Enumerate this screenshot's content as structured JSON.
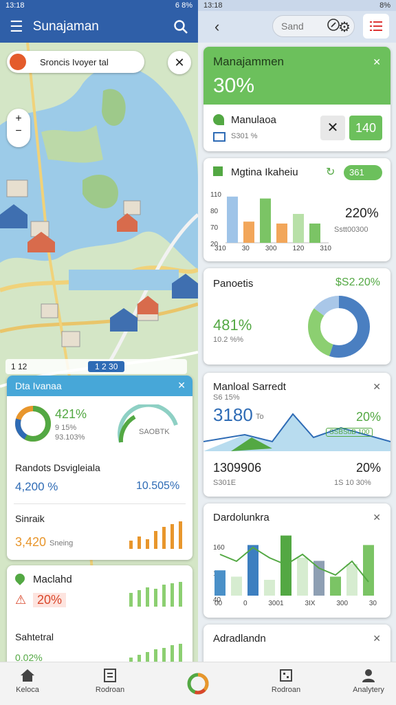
{
  "status_left": {
    "time": "13:18",
    "right": "6 8%"
  },
  "status_right": {
    "time": "13:18",
    "right": "8%"
  },
  "appbar": {
    "title": "Sunajaman"
  },
  "search": {
    "placeholder": "Sand"
  },
  "map": {
    "chip_label": "Sroncis Ivoyer tal",
    "scale_left": "1 12",
    "scale_mid": "1 2 30"
  },
  "card_data": {
    "title": "Dta Ivanaa",
    "donut_value": "421%",
    "donut_sub1": "9 15%",
    "donut_sub2": "93.103%",
    "gauge_label": "SAOBTK",
    "row1_label": "Randots Dsvigleiala",
    "row1_left": "4,200 %",
    "row1_right": "10.505%",
    "row2_label": "Sinraik",
    "row2_value": "3,420",
    "row2_sub": "Sneing"
  },
  "card_macland": {
    "title": "Maclahd",
    "value": "20%",
    "row_label": "Sahtetral",
    "row_value": "0.02%"
  },
  "card_management": {
    "title": "Manajammen",
    "value": "30%",
    "sub_label": "Manulaoa",
    "sub_value": "S301 %",
    "button_value": "140"
  },
  "card_matina": {
    "title": "Mgtina Ikaheiu",
    "badge": "361",
    "y_labels": [
      "110",
      "80",
      "70",
      "20"
    ],
    "x_labels": [
      "310",
      "30",
      "300",
      "120",
      "310"
    ],
    "value": "220%",
    "sub": "Sstt00300"
  },
  "card_panoetis": {
    "title": "Panoetis",
    "value_top": "$S2.20%",
    "value_mid": "481%",
    "sub": "10.2 %%"
  },
  "card_manual": {
    "title": "Manloal Sarredt",
    "sub_top": "S6 15%",
    "value_left": "3180",
    "unit_left": "To",
    "value_right": "20%",
    "sub_right": "SSBSuB 100",
    "bottom_left": "1309906",
    "bottom_right": "20%",
    "bottom_sub_left": "S301E",
    "bottom_sub_right": "1S 10 30%"
  },
  "card_dardol": {
    "title": "Dardolunkra",
    "y_labels": [
      "160",
      "150",
      "40"
    ],
    "x_labels": [
      "00",
      "0",
      "3001",
      "3IX",
      "300",
      "30"
    ]
  },
  "card_adra": {
    "title": "Adradlandn"
  },
  "nav": {
    "items": [
      "Keloca",
      "Rodroan",
      "",
      "Rodroan",
      "Analytery"
    ]
  },
  "colors": {
    "green": "#53a843",
    "blue": "#2e6bb5",
    "orange": "#e8962c",
    "appbar": "#2f5fa8"
  },
  "chart_data": [
    {
      "type": "bar",
      "title": "Mgtina Ikaheiu",
      "categories": [
        "310",
        "30",
        "300",
        "120",
        "310"
      ],
      "series": [
        {
          "values": [
            48,
            22,
            46,
            20,
            30,
            20
          ]
        }
      ]
    },
    {
      "type": "pie",
      "title": "Panoetis",
      "values": [
        55,
        30,
        15
      ]
    },
    {
      "type": "bar",
      "title": "Dardolunkra",
      "categories": [
        "00",
        "0",
        "3001",
        "3IX",
        "300",
        "30"
      ],
      "series": [
        {
          "values": [
            40,
            30,
            80,
            25,
            95,
            60,
            55,
            30,
            50,
            80
          ]
        }
      ]
    }
  ]
}
